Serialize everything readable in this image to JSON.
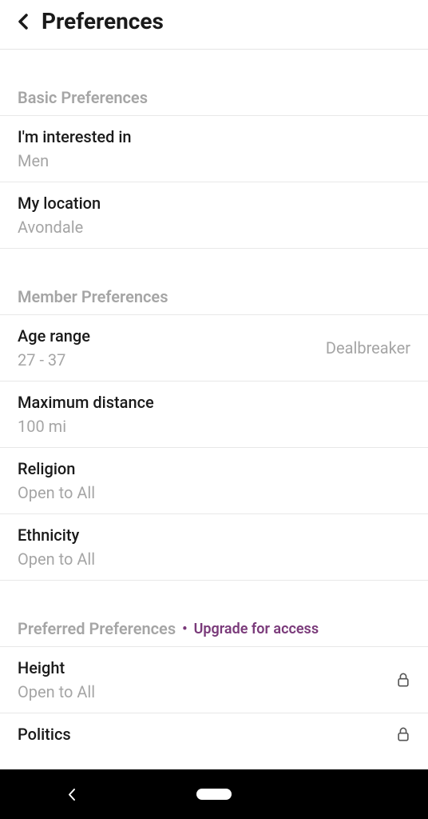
{
  "header": {
    "title": "Preferences"
  },
  "sections": {
    "basic": {
      "title": "Basic Preferences",
      "interested": {
        "label": "I'm interested in",
        "value": "Men"
      },
      "location": {
        "label": "My location",
        "value": "Avondale"
      }
    },
    "member": {
      "title": "Member Preferences",
      "age": {
        "label": "Age range",
        "value": "27 - 37",
        "badge": "Dealbreaker"
      },
      "distance": {
        "label": "Maximum distance",
        "value": "100 mi"
      },
      "religion": {
        "label": "Religion",
        "value": "Open to All"
      },
      "ethnicity": {
        "label": "Ethnicity",
        "value": "Open to All"
      }
    },
    "preferred": {
      "title": "Preferred Preferences",
      "upgrade": "Upgrade for access",
      "height": {
        "label": "Height",
        "value": "Open to All"
      },
      "politics": {
        "label": "Politics"
      }
    }
  }
}
